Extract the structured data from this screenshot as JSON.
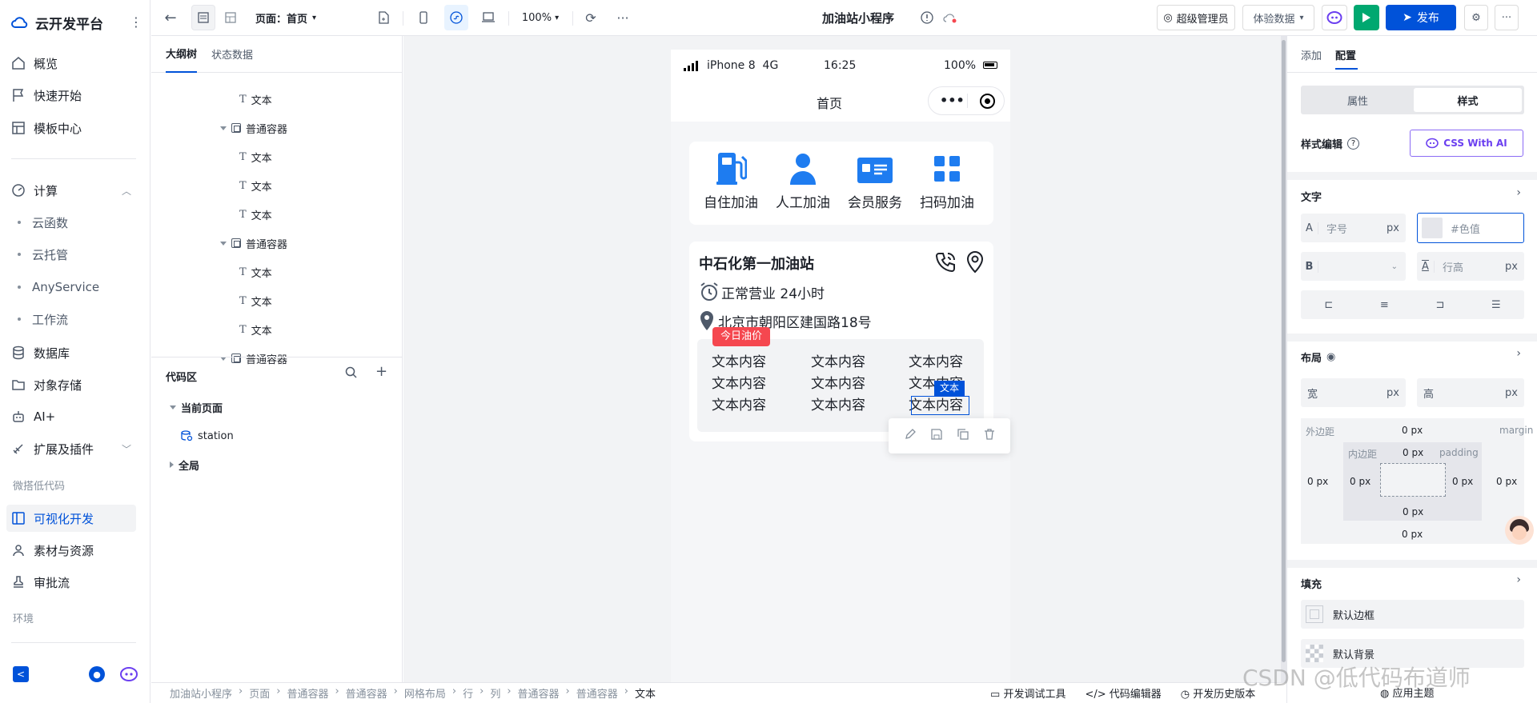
{
  "app": {
    "title": "云开发平台"
  },
  "nav": {
    "items": [
      {
        "label": "概览",
        "icon": "home-icon"
      },
      {
        "label": "快速开始",
        "icon": "flag-icon"
      },
      {
        "label": "模板中心",
        "icon": "template-icon"
      }
    ],
    "compute": {
      "label": "计算",
      "children": [
        "云函数",
        "云托管",
        "AnyService",
        "工作流"
      ]
    },
    "items2": [
      {
        "label": "数据库",
        "icon": "database-icon"
      },
      {
        "label": "对象存储",
        "icon": "folder-icon"
      },
      {
        "label": "AI+",
        "icon": "robot-icon"
      },
      {
        "label": "扩展及插件",
        "icon": "plugin-icon"
      }
    ],
    "group_lowcode": "微搭低代码",
    "items3": [
      {
        "label": "可视化开发",
        "icon": "layout-icon",
        "active": true
      },
      {
        "label": "素材与资源",
        "icon": "assets-icon"
      },
      {
        "label": "审批流",
        "icon": "stamp-icon"
      }
    ],
    "group_env": "环境"
  },
  "topbar": {
    "page_label": "页面：",
    "page_value": "首页",
    "zoom": "100%",
    "app_title": "加油站小程序",
    "user": "超级管理员",
    "data_mode": "体验数据",
    "publish": "发布"
  },
  "outline": {
    "tabs": [
      "大纲树",
      "状态数据"
    ],
    "rows": [
      {
        "label": "文本",
        "type": "text",
        "indent": 2
      },
      {
        "label": "普通容器",
        "type": "box",
        "indent": 1
      },
      {
        "label": "文本",
        "type": "text",
        "indent": 2
      },
      {
        "label": "文本",
        "type": "text",
        "indent": 2
      },
      {
        "label": "文本",
        "type": "text",
        "indent": 2
      },
      {
        "label": "普通容器",
        "type": "box",
        "indent": 1
      },
      {
        "label": "文本",
        "type": "text",
        "indent": 2
      },
      {
        "label": "文本",
        "type": "text",
        "indent": 2
      },
      {
        "label": "文本",
        "type": "text",
        "indent": 2
      },
      {
        "label": "普通容器",
        "type": "box",
        "indent": 1
      }
    ],
    "code_title": "代码区",
    "current_page": "当前页面",
    "station": "station",
    "global": "全局"
  },
  "phone": {
    "device": "iPhone 8",
    "network": "4G",
    "time": "16:25",
    "battery": "100%",
    "nav_title": "首页",
    "quick": [
      {
        "label": "自住加油",
        "icon": "fuel-pump-icon"
      },
      {
        "label": "人工加油",
        "icon": "person-icon"
      },
      {
        "label": "会员服务",
        "icon": "member-card-icon"
      },
      {
        "label": "扫码加油",
        "icon": "grid-apps-icon"
      }
    ],
    "station_name": "中石化第一加油站",
    "hours": "正常营业 24小时",
    "address": "北京市朝阳区建国路18号",
    "price_badge": "今日油价",
    "cells": [
      "文本内容",
      "文本内容",
      "文本内容",
      "文本内容",
      "文本内容",
      "文本内容",
      "文本内容",
      "文本内容",
      "文本内容"
    ],
    "selected_tag": "文本"
  },
  "right": {
    "tabs": [
      "添加",
      "配置"
    ],
    "seg": [
      "属性",
      "样式"
    ],
    "style_edit": "样式编辑",
    "css_ai": "CSS With AI",
    "text_section": "文字",
    "font_size_ph": "字号",
    "color_ph": "#色值",
    "line_height_ph": "行高",
    "unit": "px",
    "layout_section": "布局",
    "width": "宽",
    "height": "高",
    "margin_label": "外边距",
    "margin_en": "margin",
    "padding_label": "内边距",
    "padding_en": "padding",
    "zero_px": "0 px",
    "fill_section": "填充",
    "default_border": "默认边框",
    "default_bg": "默认背景"
  },
  "breadcrumb": [
    "加油站小程序",
    "页面",
    "普通容器",
    "普通容器",
    "网格布局",
    "行",
    "列",
    "普通容器",
    "普通容器",
    "文本"
  ],
  "bottom_tools": [
    "开发调试工具",
    "代码编辑器",
    "开发历史版本",
    "应用主题"
  ],
  "watermark": "CSDN @低代码布道师",
  "colors": {
    "primary": "#0052d9",
    "fuel_blue": "#1e7cf0",
    "badge_red": "#f5474f",
    "green": "#00a870"
  }
}
